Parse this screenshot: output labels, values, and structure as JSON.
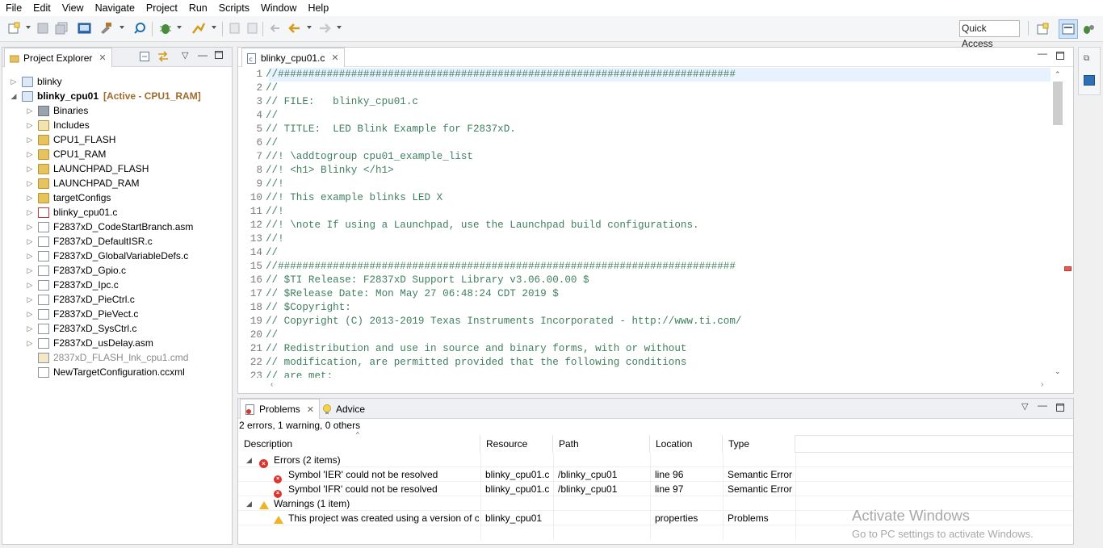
{
  "menu": [
    "File",
    "Edit",
    "View",
    "Navigate",
    "Project",
    "Run",
    "Scripts",
    "Window",
    "Help"
  ],
  "quick_access": "Quick Access",
  "explorer": {
    "tab_label": "Project Explorer",
    "items": [
      {
        "label": "blinky",
        "type": "project",
        "expanded": false,
        "indent": 0
      },
      {
        "label": "blinky_cpu01",
        "annotation": "[Active - CPU1_RAM]",
        "type": "project",
        "expanded": true,
        "indent": 0
      },
      {
        "label": "Binaries",
        "type": "binaries",
        "indent": 1
      },
      {
        "label": "Includes",
        "type": "includes",
        "indent": 1
      },
      {
        "label": "CPU1_FLASH",
        "type": "folder",
        "indent": 1
      },
      {
        "label": "CPU1_RAM",
        "type": "folder",
        "indent": 1
      },
      {
        "label": "LAUNCHPAD_FLASH",
        "type": "folder",
        "indent": 1
      },
      {
        "label": "LAUNCHPAD_RAM",
        "type": "folder",
        "indent": 1
      },
      {
        "label": "targetConfigs",
        "type": "folder",
        "indent": 1
      },
      {
        "label": "blinky_cpu01.c",
        "type": "file-error",
        "indent": 1
      },
      {
        "label": "F2837xD_CodeStartBranch.asm",
        "type": "file",
        "indent": 1
      },
      {
        "label": "F2837xD_DefaultISR.c",
        "type": "file",
        "indent": 1
      },
      {
        "label": "F2837xD_GlobalVariableDefs.c",
        "type": "file",
        "indent": 1
      },
      {
        "label": "F2837xD_Gpio.c",
        "type": "file",
        "indent": 1
      },
      {
        "label": "F2837xD_Ipc.c",
        "type": "file",
        "indent": 1
      },
      {
        "label": "F2837xD_PieCtrl.c",
        "type": "file",
        "indent": 1
      },
      {
        "label": "F2837xD_PieVect.c",
        "type": "file",
        "indent": 1
      },
      {
        "label": "F2837xD_SysCtrl.c",
        "type": "file",
        "indent": 1
      },
      {
        "label": "F2837xD_usDelay.asm",
        "type": "file",
        "indent": 1
      },
      {
        "label": "2837xD_FLASH_lnk_cpu1.cmd",
        "type": "file-excluded",
        "indent": 1
      },
      {
        "label": "NewTargetConfiguration.ccxml",
        "type": "file-plain",
        "indent": 1
      }
    ]
  },
  "editor": {
    "tab_label": "blinky_cpu01.c",
    "lines": [
      {
        "n": "1",
        "text": "//###########################################################################"
      },
      {
        "n": "2",
        "text": "//"
      },
      {
        "n": "3",
        "text": "// FILE:   blinky_cpu01.c"
      },
      {
        "n": "4",
        "text": "//"
      },
      {
        "n": "5",
        "text": "// TITLE:  LED Blink Example for F2837xD."
      },
      {
        "n": "6",
        "text": "//"
      },
      {
        "n": "7",
        "text": "//! \\addtogroup cpu01_example_list"
      },
      {
        "n": "8",
        "text": "//! <h1> Blinky </h1>"
      },
      {
        "n": "9",
        "text": "//!"
      },
      {
        "n": "10",
        "text": "//! This example blinks LED X"
      },
      {
        "n": "11",
        "text": "//!"
      },
      {
        "n": "12",
        "text": "//! \\note If using a Launchpad, use the Launchpad build configurations."
      },
      {
        "n": "13",
        "text": "//!"
      },
      {
        "n": "14",
        "text": "//"
      },
      {
        "n": "15",
        "text": "//###########################################################################"
      },
      {
        "n": "16",
        "text": "// $TI Release: F2837xD Support Library v3.06.00.00 $"
      },
      {
        "n": "17",
        "text": "// $Release Date: Mon May 27 06:48:24 CDT 2019 $"
      },
      {
        "n": "18",
        "text": "// $Copyright:"
      },
      {
        "n": "19",
        "text": "// Copyright (C) 2013-2019 Texas Instruments Incorporated - http://www.ti.com/"
      },
      {
        "n": "20",
        "text": "//"
      },
      {
        "n": "21",
        "text": "// Redistribution and use in source and binary forms, with or without"
      },
      {
        "n": "22",
        "text": "// modification, are permitted provided that the following conditions"
      },
      {
        "n": "23",
        "text": "// are met:"
      }
    ]
  },
  "problems": {
    "tab_label": "Problems",
    "advice_label": "Advice",
    "summary": "2 errors, 1 warning, 0 others",
    "columns": [
      "Description",
      "Resource",
      "Path",
      "Location",
      "Type"
    ],
    "groups": [
      {
        "label": "Errors (2 items)",
        "kind": "error",
        "rows": [
          {
            "description": "Symbol 'IER' could not be resolved",
            "resource": "blinky_cpu01.c",
            "path": "/blinky_cpu01",
            "location": "line 96",
            "type": "Semantic Error"
          },
          {
            "description": "Symbol 'IFR' could not be resolved",
            "resource": "blinky_cpu01.c",
            "path": "/blinky_cpu01",
            "location": "line 97",
            "type": "Semantic Error"
          }
        ]
      },
      {
        "label": "Warnings (1 item)",
        "kind": "warning",
        "rows": [
          {
            "description": "This project was created using a version of cc",
            "resource": "blinky_cpu01",
            "path": "",
            "location": "properties",
            "type": "Problems"
          }
        ]
      }
    ]
  },
  "watermark": {
    "line1": "Activate Windows",
    "line2": "Go to PC settings to activate Windows."
  }
}
